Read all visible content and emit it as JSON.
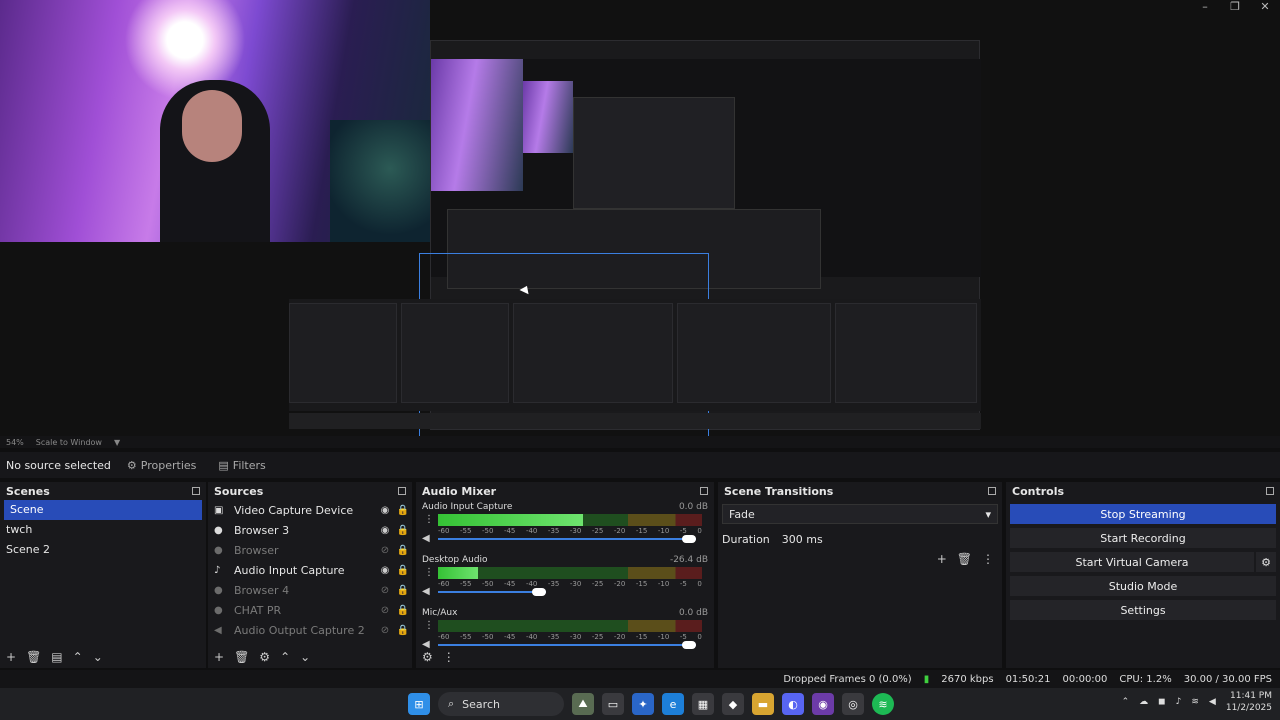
{
  "preview": {
    "zoom": "54%",
    "scale_mode": "Scale to Window"
  },
  "source_toolbar": {
    "no_selection": "No source selected",
    "properties": "Properties",
    "filters": "Filters"
  },
  "scenes": {
    "title": "Scenes",
    "items": [
      "Scene",
      "twch",
      "Scene 2"
    ],
    "selected": 0
  },
  "sources": {
    "title": "Sources",
    "items": [
      {
        "name": "Video Capture Device",
        "icon": "camera-icon",
        "visible": true
      },
      {
        "name": "Browser 3",
        "icon": "globe-icon",
        "visible": true
      },
      {
        "name": "Browser",
        "icon": "globe-icon",
        "visible": false
      },
      {
        "name": "Audio Input Capture",
        "icon": "mic-icon",
        "visible": true
      },
      {
        "name": "Browser 4",
        "icon": "globe-icon",
        "visible": false
      },
      {
        "name": "CHAT PR",
        "icon": "globe-icon",
        "visible": false
      },
      {
        "name": "Audio Output Capture 2",
        "icon": "speaker-icon",
        "visible": false
      }
    ]
  },
  "mixer": {
    "title": "Audio Mixer",
    "ticks": [
      "-60",
      "-55",
      "-50",
      "-45",
      "-40",
      "-35",
      "-30",
      "-25",
      "-20",
      "-15",
      "-10",
      "-5",
      "0"
    ],
    "channels": [
      {
        "name": "Audio Input Capture",
        "db": "0.0 dB",
        "level": 0.55,
        "volume": 1.0
      },
      {
        "name": "Desktop Audio",
        "db": "-26.4 dB",
        "level": 0.15,
        "volume": 0.42
      },
      {
        "name": "Mic/Aux",
        "db": "0.0 dB",
        "level": 0.0,
        "volume": 1.0
      }
    ]
  },
  "transitions": {
    "title": "Scene Transitions",
    "selected": "Fade",
    "duration_label": "Duration",
    "duration_value": "300 ms"
  },
  "controls": {
    "title": "Controls",
    "stop_streaming": "Stop Streaming",
    "start_recording": "Start Recording",
    "start_virtual_camera": "Start Virtual Camera",
    "studio_mode": "Studio Mode",
    "settings": "Settings"
  },
  "status": {
    "dropped_frames": "Dropped Frames 0 (0.0%)",
    "bitrate": "2670 kbps",
    "stream_time": "01:50:21",
    "record_time": "00:00:00",
    "cpu": "CPU: 1.2%",
    "fps": "30.00 / 30.00 FPS"
  },
  "taskbar": {
    "search_label": "Search",
    "time": "11:41 PM",
    "date": "11/2/2025"
  },
  "colors": {
    "accent": "#284cb8",
    "meter_green": "#35c235",
    "meter_yellow": "#b5a032",
    "meter_red": "#c23535"
  }
}
